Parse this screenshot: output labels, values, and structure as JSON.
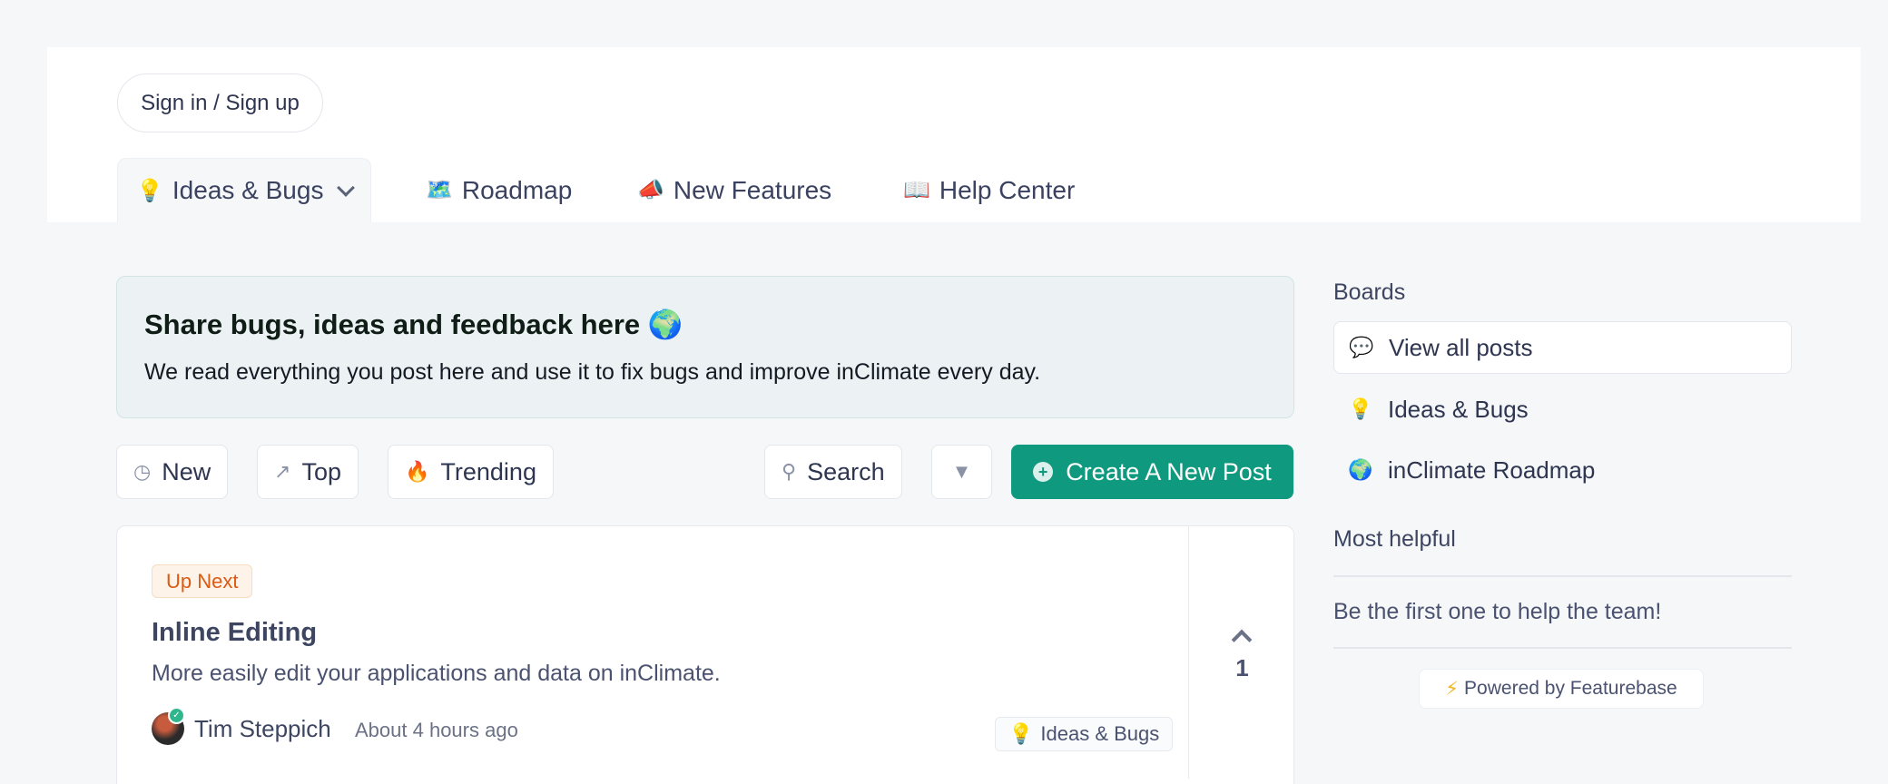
{
  "auth": {
    "signin_label": "Sign in / Sign up"
  },
  "nav": {
    "tabs": [
      {
        "emoji": "💡",
        "label": "Ideas & Bugs",
        "active": true
      },
      {
        "emoji": "🗺️",
        "label": "Roadmap"
      },
      {
        "emoji": "📣",
        "label": "New Features"
      },
      {
        "emoji": "📖",
        "label": "Help Center"
      }
    ]
  },
  "hero": {
    "title": "Share bugs, ideas and feedback here 🌍",
    "description": "We read everything you post here and use it to fix bugs and improve inClimate every day."
  },
  "toolbar": {
    "sort_new": "New",
    "sort_top": "Top",
    "sort_trending": "Trending",
    "search_label": "Search",
    "create_label": "Create A New Post",
    "icons": {
      "new": "clock-icon",
      "top": "trending-up-icon",
      "trending": "flame-icon",
      "search": "search-icon",
      "filter": "filter-icon",
      "create": "plus-circle-icon"
    }
  },
  "post": {
    "status": "Up Next",
    "title": "Inline Editing",
    "description": "More easily edit your applications and data on inClimate.",
    "author": "Tim Steppich",
    "time": "About 4 hours ago",
    "board_emoji": "💡",
    "board": "Ideas & Bugs",
    "votes": "1"
  },
  "sidebar": {
    "boards_heading": "Boards",
    "boards": [
      {
        "icon": "chat-bubbles-icon",
        "label": "View all posts",
        "active": true
      },
      {
        "emoji": "💡",
        "label": "Ideas & Bugs"
      },
      {
        "emoji": "🌍",
        "label": "inClimate Roadmap"
      }
    ],
    "helpful_heading": "Most helpful",
    "helpful_empty": "Be the first one to help the team!",
    "powered_by": "Powered by Featurebase"
  },
  "colors": {
    "accent": "#0f9a7f",
    "status_orange": "#dc5a14",
    "background": "#f5f7f9"
  }
}
